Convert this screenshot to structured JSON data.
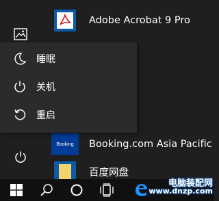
{
  "colors": {
    "menu_bg": "#1f1f1f",
    "flyout_bg": "#2b2b2b",
    "taskbar_bg": "#101010",
    "accent_blue": "#0a5ba8",
    "booking_blue": "#003b95",
    "edge_blue": "#1e90ff",
    "acrobat_red": "#d4191f"
  },
  "rail": {
    "items": [
      {
        "icon": "pictures-icon"
      },
      {
        "icon": "power-icon"
      }
    ]
  },
  "apps": [
    {
      "label": "Adobe Acrobat 9 Pro",
      "icon": "acrobat-icon"
    },
    {
      "label": "Booking.com Asia Pacific",
      "tile_text": "Booking",
      "icon": "booking-icon"
    },
    {
      "label": "百度网盘",
      "icon": "baidu-netdisk-icon"
    }
  ],
  "power_menu": {
    "items": [
      {
        "label": "睡眠",
        "icon": "moon-icon"
      },
      {
        "label": "关机",
        "icon": "power-icon"
      },
      {
        "label": "重启",
        "icon": "restart-icon"
      }
    ]
  },
  "taskbar": {
    "items": [
      {
        "icon": "windows-logo-icon"
      },
      {
        "icon": "search-icon"
      },
      {
        "icon": "cortana-icon"
      },
      {
        "icon": "task-view-icon"
      },
      {
        "icon": "edge-icon"
      }
    ]
  },
  "watermark": {
    "line1": "电脑装配网",
    "line2": "www.dnzp.com"
  }
}
